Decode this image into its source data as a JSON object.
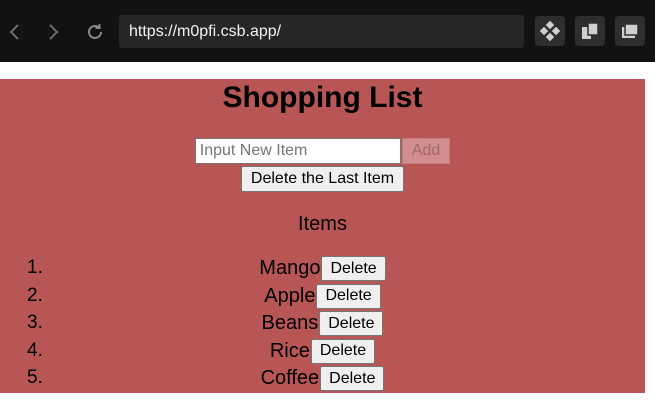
{
  "browser": {
    "url": "https://m0pfi.csb.app/",
    "icons": {
      "back": "chevron-left-icon",
      "forward": "chevron-right-icon",
      "reload": "reload-icon",
      "tool1": "sandbox-cube-icon",
      "tool2": "split-view-icon",
      "tool3": "window-icon"
    }
  },
  "app": {
    "title": "Shopping List",
    "input_placeholder": "Input New Item",
    "input_value": "",
    "add_label": "Add",
    "delete_last_label": "Delete the Last Item",
    "items_heading": "Items",
    "items": [
      {
        "number": "1.",
        "name": "Mango",
        "delete_label": "Delete"
      },
      {
        "number": "2.",
        "name": "Apple",
        "delete_label": "Delete"
      },
      {
        "number": "3.",
        "name": "Beans",
        "delete_label": "Delete"
      },
      {
        "number": "4.",
        "name": "Rice",
        "delete_label": "Delete"
      },
      {
        "number": "5.",
        "name": "Coffee",
        "delete_label": "Delete"
      }
    ]
  },
  "colors": {
    "chrome_bg": "#121212",
    "page_bg": "#b85555",
    "add_button_disabled": "#d28e8e"
  }
}
